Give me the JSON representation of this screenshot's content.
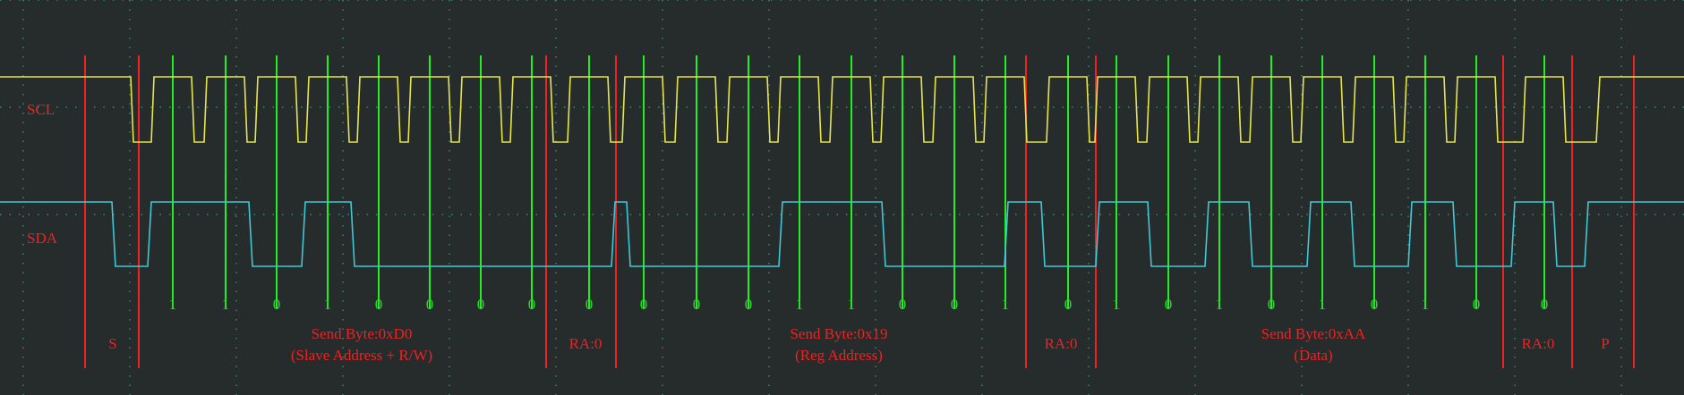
{
  "channels": {
    "scl": {
      "label": "SCL",
      "color": "#e6e64a"
    },
    "sda": {
      "label": "SDA",
      "color": "#3fc9d8"
    }
  },
  "marker_colors": {
    "clock": "#22ee22",
    "segment": "#ee2222",
    "bit_text": "#22dd22",
    "seg_text": "#ee2222"
  },
  "bits": [
    "1",
    "1",
    "0",
    "1",
    "0",
    "0",
    "0",
    "0",
    "0",
    "0",
    "0",
    "0",
    "1",
    "1",
    "0",
    "0",
    "1",
    "0",
    "1",
    "0",
    "1",
    "0",
    "1",
    "0",
    "1",
    "0",
    "0"
  ],
  "segments": {
    "start": "S",
    "byte1_title": "Send Byte:0xD0",
    "byte1_sub": "(Slave Address + R/W)",
    "ack1": "RA:0",
    "byte2_title": "Send Byte:0x19",
    "byte2_sub": "(Reg Address)",
    "ack2": "RA:0",
    "byte3_title": "Send Byte:0xAA",
    "byte3_sub": "(Data)",
    "ack3": "RA:0",
    "stop": "P"
  }
}
